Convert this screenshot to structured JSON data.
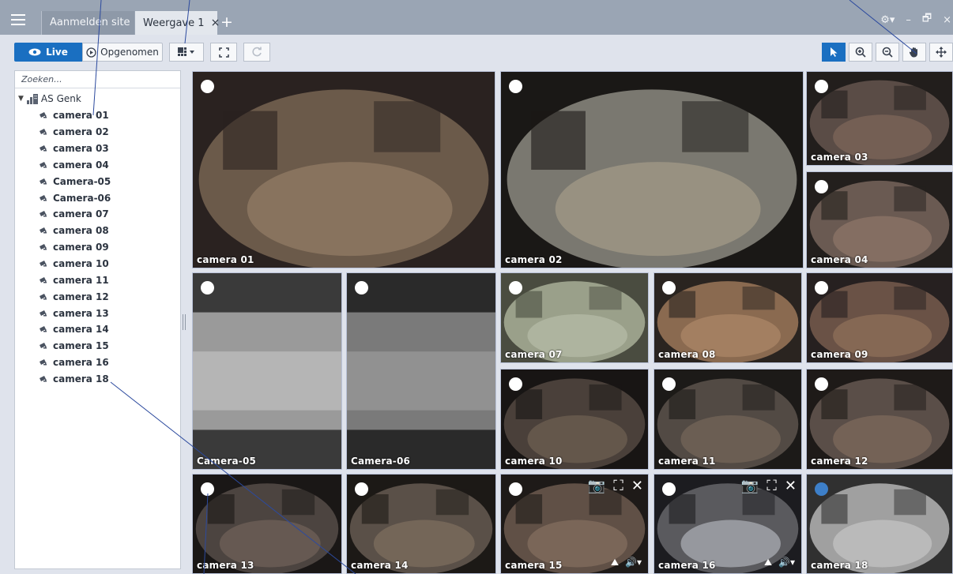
{
  "topbar": {
    "tabs": [
      {
        "label": "Aanmelden site"
      },
      {
        "label": "Weergave 1",
        "close": "×"
      }
    ],
    "add_tab": "+",
    "window_controls": {
      "settings": "⚙▾",
      "minimize": "–",
      "restore": "🗗",
      "close": "×"
    }
  },
  "toolbar": {
    "live_label": "Live",
    "recorded_label": "Opgenomen",
    "layout_icon": "layout-grid-icon",
    "fullscreen_icon": "fullscreen-icon",
    "refresh_icon": "refresh-icon",
    "right_tools": [
      "pointer-icon",
      "zoom-in-icon",
      "zoom-out-icon",
      "hand-icon",
      "move-icon"
    ],
    "accent_color": "#1a6fc1"
  },
  "sidebar": {
    "search_placeholder": "Zoeken...",
    "site_name": "AS Genk",
    "cameras": [
      "camera 01",
      "camera 02",
      "camera 03",
      "camera 04",
      "Camera-05",
      "Camera-06",
      "camera 07",
      "camera 08",
      "camera 09",
      "camera 10",
      "camera 11",
      "camera 12",
      "camera 13",
      "camera 14",
      "camera 15",
      "camera 16",
      "camera 18"
    ]
  },
  "grid": {
    "tiles": [
      {
        "label": "camera 01"
      },
      {
        "label": "camera 02"
      },
      {
        "label": "camera 03"
      },
      {
        "label": "camera 04"
      },
      {
        "label": "Camera-05"
      },
      {
        "label": "Camera-06"
      },
      {
        "label": "camera 07"
      },
      {
        "label": "camera 08"
      },
      {
        "label": "camera 09"
      },
      {
        "label": "camera 10"
      },
      {
        "label": "camera 11"
      },
      {
        "label": "camera 12"
      },
      {
        "label": "camera 13"
      },
      {
        "label": "camera 14"
      },
      {
        "label": "camera 15",
        "tools": true
      },
      {
        "label": "camera 16",
        "tools": true
      },
      {
        "label": "camera 18",
        "blue_dot": true
      }
    ]
  }
}
